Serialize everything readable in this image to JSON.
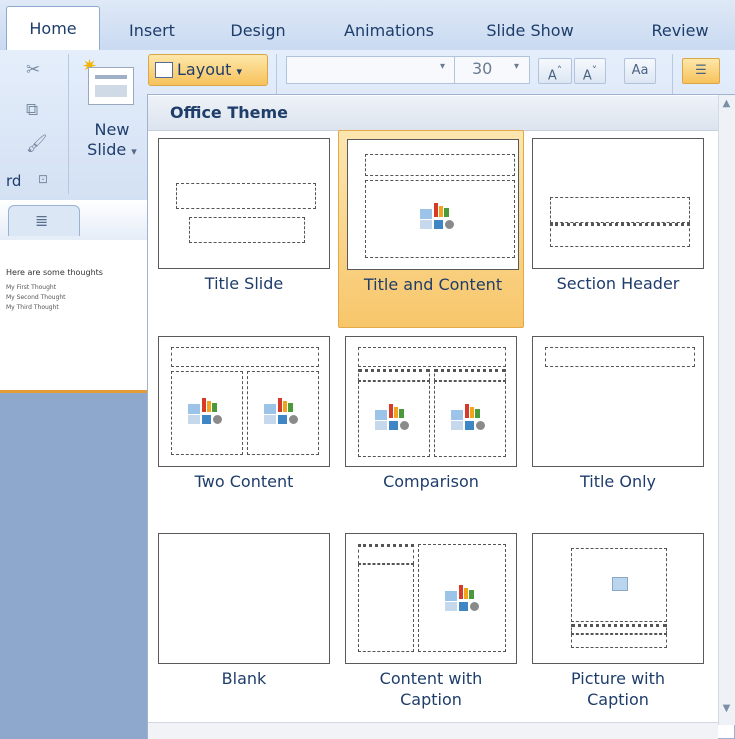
{
  "ribbon": {
    "tabs": [
      "Home",
      "Insert",
      "Design",
      "Animations",
      "Slide Show",
      "Review"
    ],
    "active_tab": "Home",
    "new_slide_label_1": "New",
    "new_slide_label_2": "Slide",
    "layout_label": "Layout",
    "font_size": "30",
    "group_label_fragment": "rd",
    "dropdown_arrow": "▾"
  },
  "slide_panel": {
    "thumb_title": "Here are some thoughts",
    "thumb_lines": [
      "My First Thought",
      "My Second Thought",
      "My Third Thought"
    ]
  },
  "gallery": {
    "header": "Office Theme",
    "selected": "Title and Content",
    "layouts": [
      "Title Slide",
      "Title and Content",
      "Section Header",
      "Two Content",
      "Comparison",
      "Title Only",
      "Blank",
      "Content with\nCaption",
      "Picture with\nCaption"
    ]
  },
  "colors": {
    "selection": "#f7c66a",
    "ribbon_text": "#1e3d6b"
  }
}
